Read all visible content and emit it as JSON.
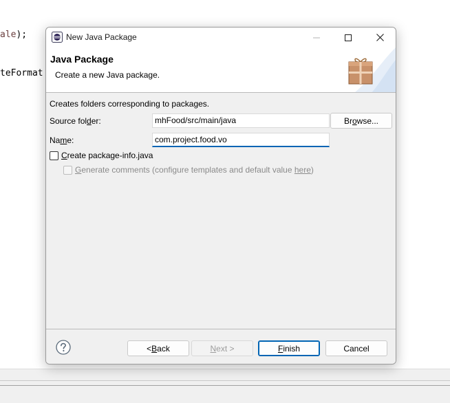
{
  "editor": {
    "line1": {
      "text": "ale",
      "suffix": ");"
    },
    "line2": {
      "text": "teFormat"
    }
  },
  "dialog": {
    "title": "New Java Package",
    "banner": {
      "heading": "Java Package",
      "description": "Create a new Java package."
    },
    "intro": "Creates folders corresponding to packages.",
    "source_folder": {
      "label_pre": "Source fol",
      "label_accel": "d",
      "label_post": "er:",
      "value": "mhFood/src/main/java",
      "browse_pre": "Br",
      "browse_accel": "o",
      "browse_post": "wse..."
    },
    "name": {
      "label_pre": "Na",
      "label_accel": "m",
      "label_post": "e:",
      "value": "com.project.food.vo"
    },
    "create_package_info": {
      "accel": "C",
      "label": "reate package-info.java",
      "checked": false
    },
    "generate_comments": {
      "accel": "G",
      "label": "enerate comments (configure templates and default value ",
      "link": "here",
      "suffix": ")",
      "checked": false,
      "enabled": false
    },
    "buttons": {
      "back_pre": "< ",
      "back_accel": "B",
      "back_post": "ack",
      "next_accel": "N",
      "next_post": "ext >",
      "finish_accel": "F",
      "finish_post": "inish",
      "cancel": "Cancel"
    }
  },
  "icons": {
    "app": "eclipse-icon",
    "package": "package-icon",
    "help": "help-icon"
  },
  "colors": {
    "accent": "#0064b4",
    "dialog_bg": "#f0f0f0",
    "package_wood": "#c8916a"
  }
}
